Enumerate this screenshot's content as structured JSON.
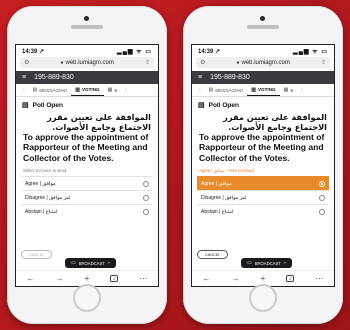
{
  "phones": [
    {
      "status": {
        "time": "14:39 ↗",
        "signal": "▂▄▆ ᯤ ▭"
      },
      "url": "web.lumiagm.com",
      "meeting_id": "195-889-830",
      "tabs": {
        "messaging": "MESSAGING",
        "voting": "VOTING",
        "more": "B"
      },
      "poll_status": "Poll Open",
      "question_ar": "الموافقة على تعيين مقرر الاجتماع وجامع الأصوات.",
      "question_en": "To approve the appointment of Rapporteur of the Meeting and Collector of the Votes.",
      "hint": "Select a choice to send",
      "options": [
        "Agree | موافق",
        "Disagree | غير موافق",
        "Abstain | امتناع"
      ],
      "selected_option": null,
      "cancel_label": "CANCEL",
      "broadcast_label": "BROADCAST",
      "tab_count": "2"
    },
    {
      "status": {
        "time": "14:39 ↗",
        "signal": "▂▄▆ ᯤ ▭"
      },
      "url": "web.lumiagm.com",
      "meeting_id": "195-889-830",
      "tabs": {
        "messaging": "MESSAGING",
        "voting": "VOTING",
        "more": "B"
      },
      "poll_status": "Poll Open",
      "question_ar": "الموافقة على تعيين مقرر الاجتماع وجامع الأصوات.",
      "question_en": "To approve the appointment of Rapporteur of the Meeting and Collector of the Votes.",
      "hint": "Agree | موافق - Vote received",
      "options": [
        "Agree | موافق",
        "Disagree | غير موافق",
        "Abstain | امتناع"
      ],
      "selected_option": 0,
      "cancel_label": "CANCEL",
      "broadcast_label": "BROADCAST",
      "tab_count": "2"
    }
  ],
  "colors": {
    "background": "#c81e23",
    "selected": "#e98b2a",
    "appbar": "#3a3a40"
  },
  "icons": [
    "back-icon",
    "forward-icon",
    "add-icon",
    "tabs-icon",
    "more-icon",
    "menu-icon",
    "chat-icon",
    "ballot-icon",
    "broadcast-icon"
  ]
}
